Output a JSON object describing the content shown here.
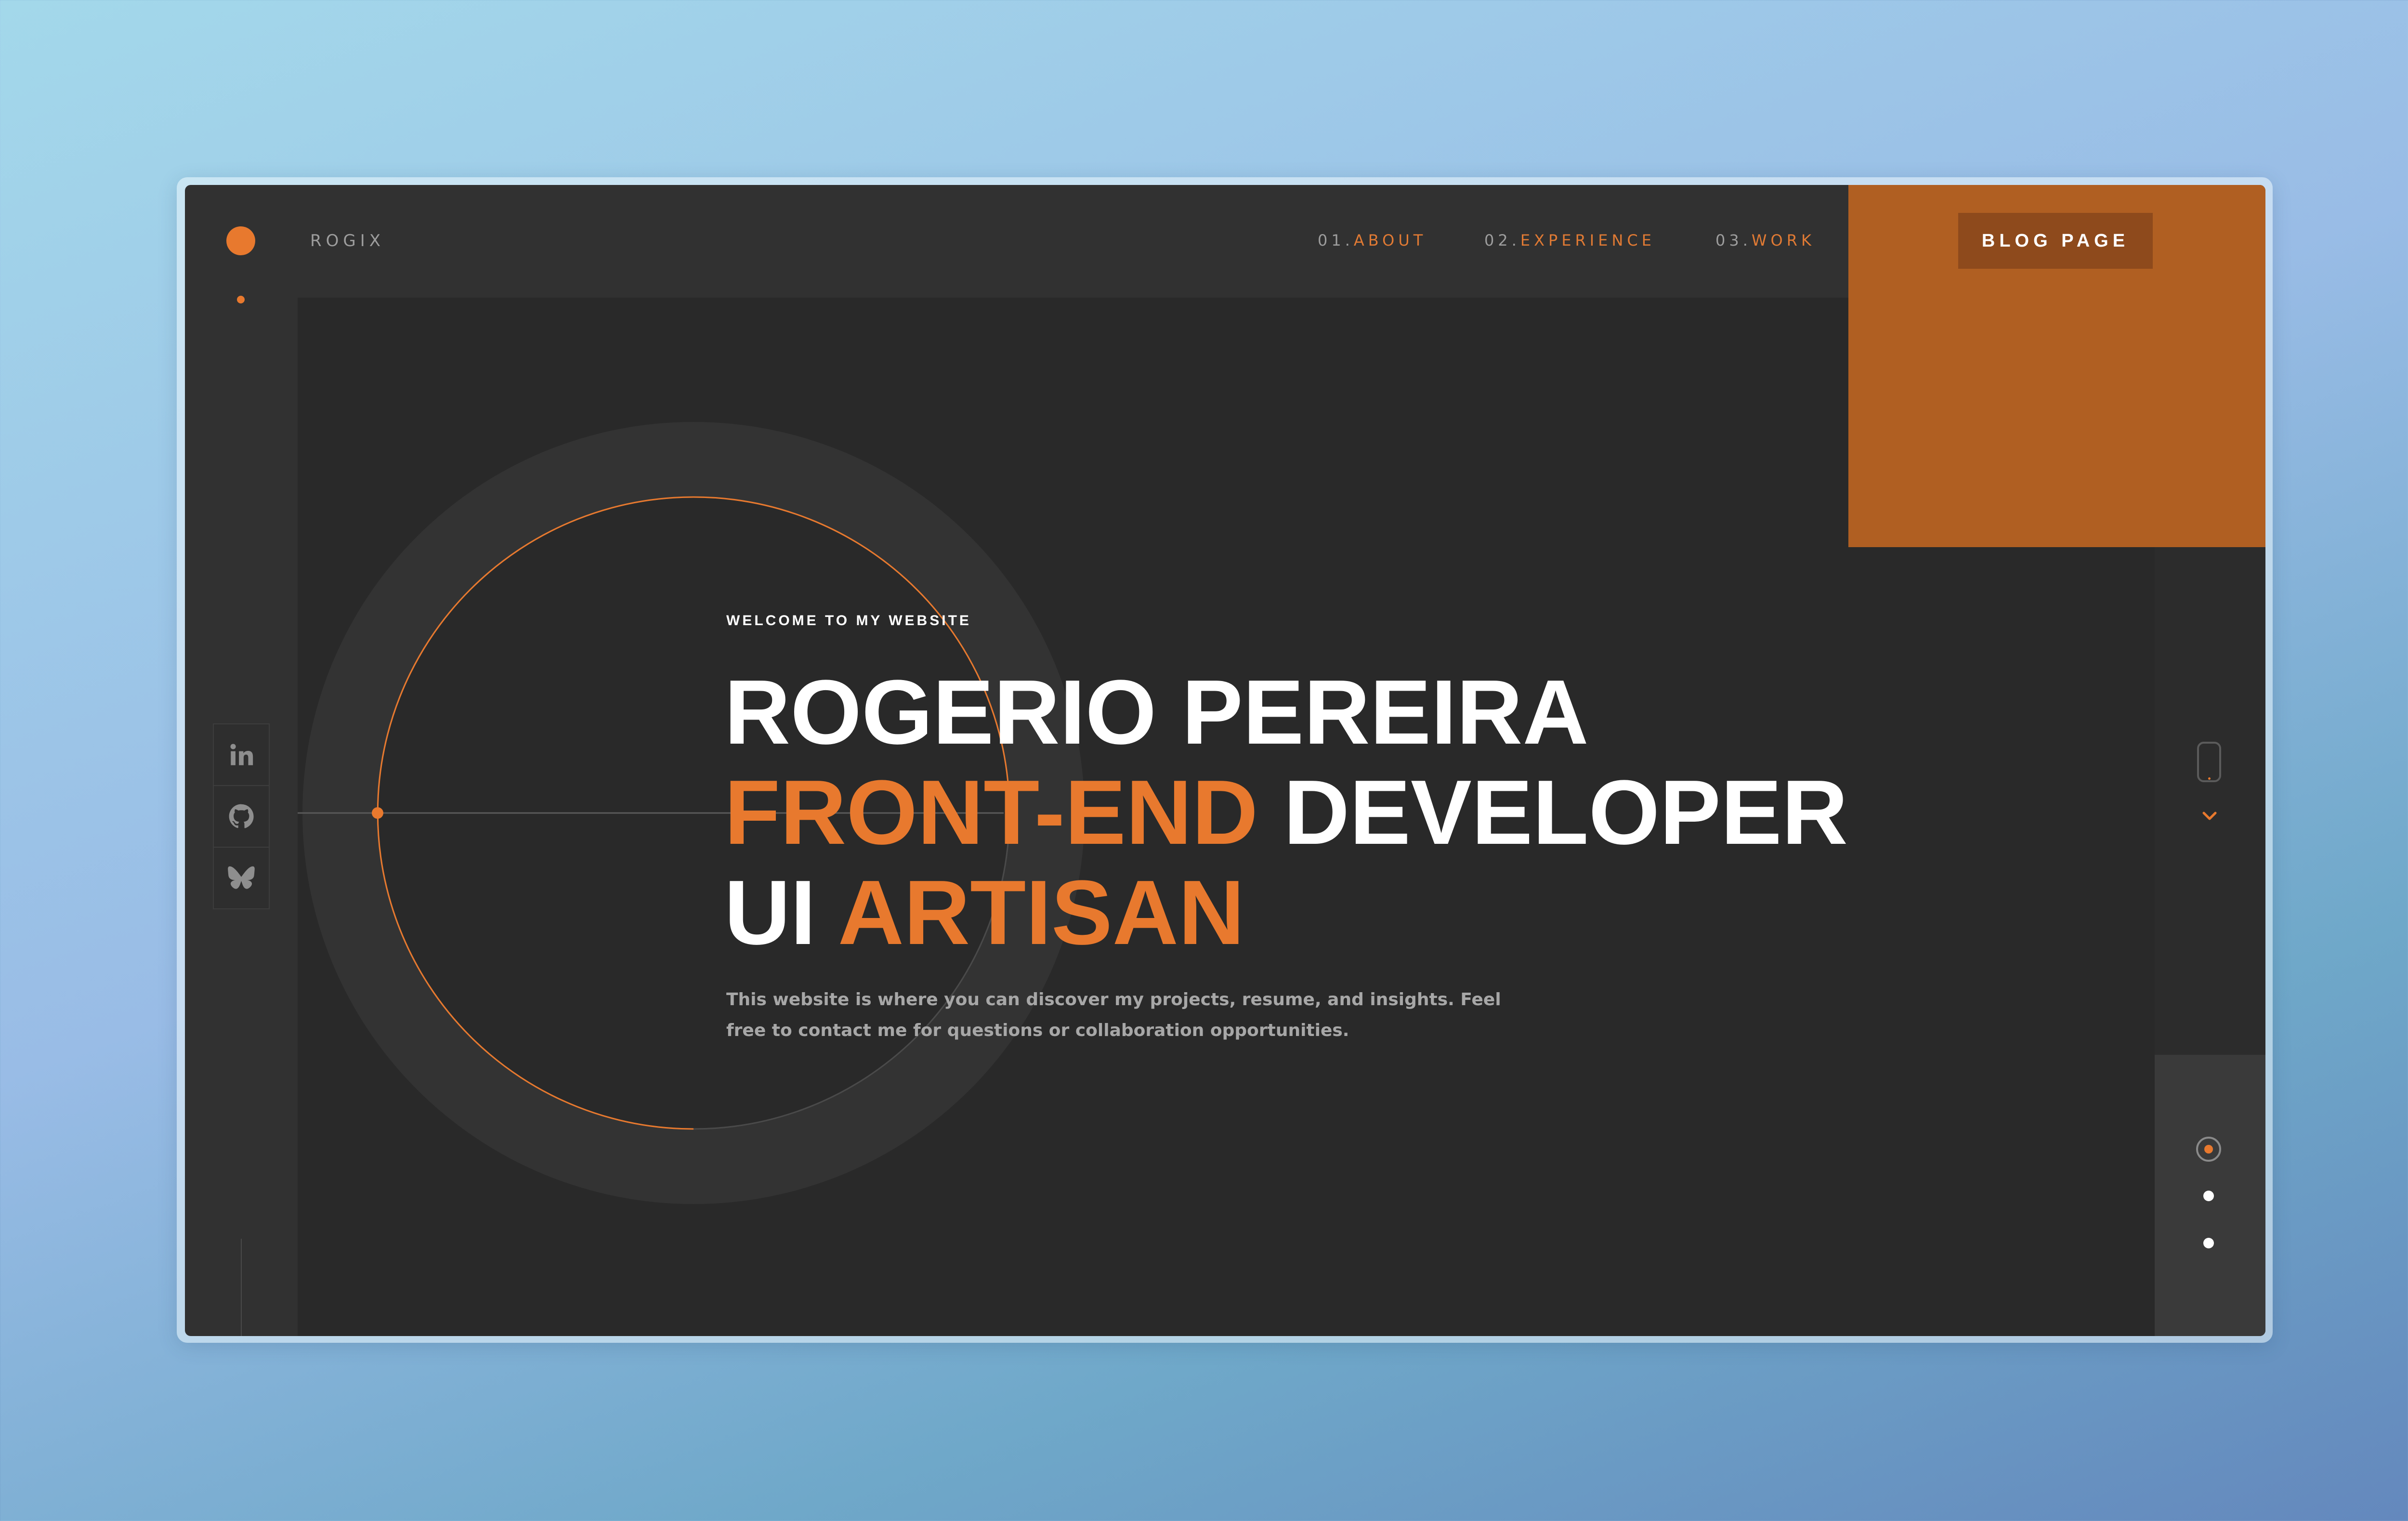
{
  "header": {
    "brand": "ROGIX",
    "nav": [
      {
        "num": "01.",
        "label": "ABOUT"
      },
      {
        "num": "02.",
        "label": "EXPERIENCE"
      },
      {
        "num": "03.",
        "label": "WORK"
      }
    ],
    "blog_label": "BLOG PAGE"
  },
  "hero": {
    "welcome": "WELCOME TO MY WEBSITE",
    "name": "ROGERIO PEREIRA",
    "line2_accent": "FRONT-END",
    "line2_rest": "DEVELOPER",
    "line3_plain": "UI",
    "line3_accent": "ARTISAN",
    "description": "This website is where you can discover my projects, resume, and insights. Feel free to contact me for questions or collaboration opportunities."
  },
  "social": [
    {
      "icon": "linkedin-icon"
    },
    {
      "icon": "github-icon"
    },
    {
      "icon": "butterfly-icon"
    }
  ],
  "pager": {
    "count": 3,
    "active": 1
  },
  "colors": {
    "accent": "#e8792e",
    "panel": "#b05f22",
    "button": "#8e4a1c",
    "background": "#292929",
    "frame": "#313131"
  }
}
